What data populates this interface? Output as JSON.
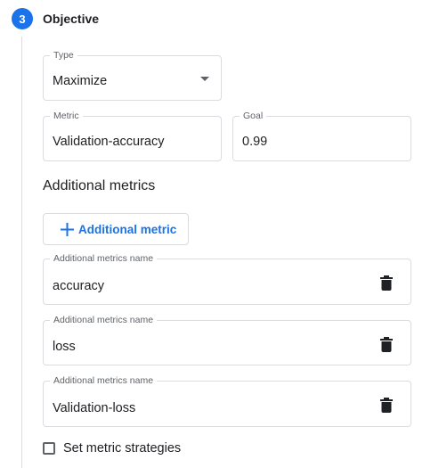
{
  "step": {
    "number": "3",
    "title": "Objective"
  },
  "type_field": {
    "label": "Type",
    "value": "Maximize"
  },
  "metric_field": {
    "label": "Metric",
    "value": "Validation-accuracy"
  },
  "goal_field": {
    "label": "Goal",
    "value": "0.99"
  },
  "additional_metrics": {
    "heading": "Additional metrics",
    "add_button_label": "Additional metric",
    "items": [
      {
        "label": "Additional metrics name",
        "value": "accuracy"
      },
      {
        "label": "Additional metrics name",
        "value": "loss"
      },
      {
        "label": "Additional metrics name",
        "value": "Validation-loss"
      }
    ]
  },
  "strategies_checkbox": {
    "label": "Set metric strategies",
    "checked": false
  },
  "colors": {
    "accent": "#1a73e8",
    "border": "#dadce0",
    "text": "#202124",
    "muted": "#5f6368"
  },
  "icons": {
    "add": "plus-icon",
    "delete": "trash-icon",
    "dropdown": "caret-down-icon"
  }
}
